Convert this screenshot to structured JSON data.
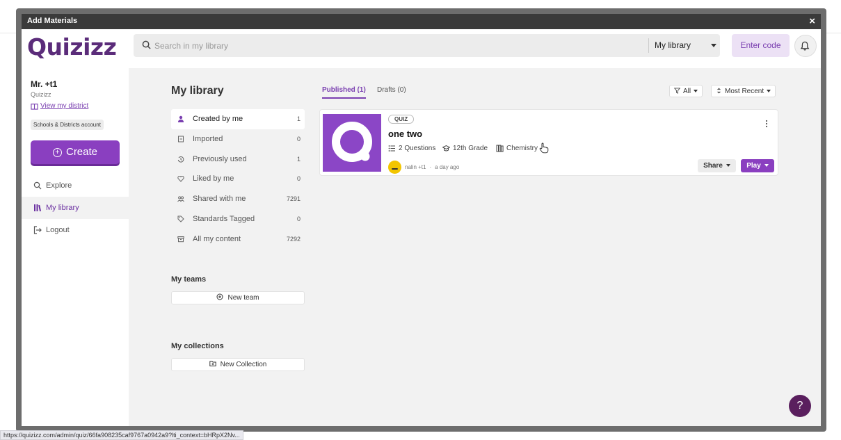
{
  "modal": {
    "title": "Add Materials",
    "close": "×"
  },
  "header": {
    "logo": "Quizizz",
    "search_placeholder": "Search in my library",
    "scope": "My library",
    "enter_code": "Enter code"
  },
  "sidebar": {
    "user_name": "Mr. +t1",
    "org": "Quizizz",
    "district_link": "View my district",
    "account_badge": "Schools & Districts account",
    "create": "Create",
    "nav": [
      {
        "label": "Explore",
        "icon": "search-icon"
      },
      {
        "label": "My library",
        "icon": "library-icon",
        "active": true
      },
      {
        "label": "Logout",
        "icon": "logout-icon"
      }
    ]
  },
  "library": {
    "title": "My library",
    "filters": [
      {
        "label": "Created by me",
        "count": "1",
        "icon": "person-icon",
        "active": true
      },
      {
        "label": "Imported",
        "count": "0",
        "icon": "import-icon"
      },
      {
        "label": "Previously used",
        "count": "1",
        "icon": "history-icon"
      },
      {
        "label": "Liked by me",
        "count": "0",
        "icon": "heart-icon"
      },
      {
        "label": "Shared with me",
        "count": "7291",
        "icon": "people-icon"
      },
      {
        "label": "Standards Tagged",
        "count": "0",
        "icon": "tag-icon"
      },
      {
        "label": "All my content",
        "count": "7292",
        "icon": "archive-icon"
      }
    ],
    "teams_heading": "My teams",
    "new_team": "New team",
    "collections_heading": "My collections",
    "new_collection": "New Collection"
  },
  "tabs": [
    {
      "label": "Published (1)",
      "active": true
    },
    {
      "label": "Drafts (0)"
    }
  ],
  "filters_bar": {
    "type": "All",
    "sort": "Most Recent"
  },
  "quiz": {
    "badge": "QUIZ",
    "title": "one two",
    "questions": "2 Questions",
    "grade": "12th Grade",
    "subject": "Chemistry",
    "author": "nalin +t1",
    "time": "a day ago",
    "share": "Share",
    "play": "Play"
  },
  "help": "?",
  "status_url": "https://quizizz.com/admin/quiz/66fa908235caf9767a0942a9?lti_context=bHRpX2Nv...",
  "colors": {
    "brand": "#8a3fc0",
    "logo": "#5b2c7a",
    "help": "#5a1f5e"
  }
}
